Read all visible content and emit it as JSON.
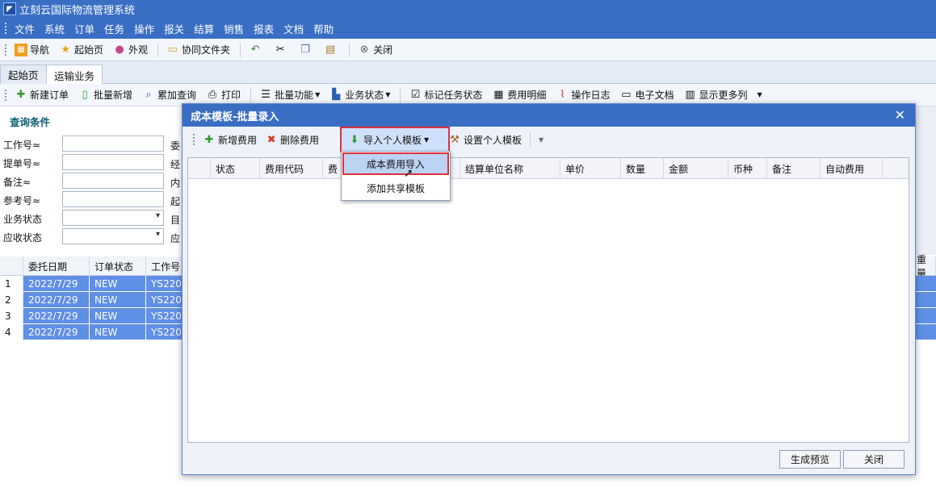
{
  "app": {
    "title": "立刻云国际物流管理系统"
  },
  "menu": [
    "文件",
    "系统",
    "订单",
    "任务",
    "操作",
    "报关",
    "结算",
    "销售",
    "报表",
    "文档",
    "帮助"
  ],
  "toolbar": {
    "nav": "导航",
    "home": "起始页",
    "skin": "外观",
    "shared_folder": "协同文件夹",
    "close": "关闭"
  },
  "tabs": [
    "起始页",
    "运输业务"
  ],
  "toolbar2": [
    "新建订单",
    "批量新增",
    "累加查询",
    "打印",
    "批量功能",
    "业务状态",
    "标记任务状态",
    "费用明细",
    "操作日志",
    "电子文档",
    "显示更多列"
  ],
  "query": {
    "title": "查询条件",
    "left": [
      "工作号≈",
      "提单号≈",
      "备注≈",
      "参考号≈",
      "业务状态",
      "应收状态"
    ],
    "right": [
      "委",
      "经",
      "内",
      "起",
      "目",
      "应"
    ]
  },
  "grid": {
    "headers": [
      "委托日期",
      "订单状态",
      "工作号"
    ],
    "right_header": "重量",
    "rows": [
      {
        "n": "1",
        "date": "2022/7/29",
        "status": "NEW",
        "job": "YS220"
      },
      {
        "n": "2",
        "date": "2022/7/29",
        "status": "NEW",
        "job": "YS220"
      },
      {
        "n": "3",
        "date": "2022/7/29",
        "status": "NEW",
        "job": "YS220"
      },
      {
        "n": "4",
        "date": "2022/7/29",
        "status": "NEW",
        "job": "YS220"
      }
    ]
  },
  "dialog": {
    "title": "成本模板-批量录入",
    "add_fee": "新增费用",
    "delete_fee": "删除费用",
    "import_template": "导入个人模板",
    "set_template": "设置个人模板",
    "columns": [
      "状态",
      "费用代码",
      "费",
      "码",
      "结算单位名称",
      "单价",
      "数量",
      "金额",
      "币种",
      "备注",
      "自动费用"
    ],
    "generate_preview": "生成预览",
    "close": "关闭"
  },
  "dropdown": {
    "items": [
      "成本费用导入",
      "添加共享模板"
    ]
  }
}
